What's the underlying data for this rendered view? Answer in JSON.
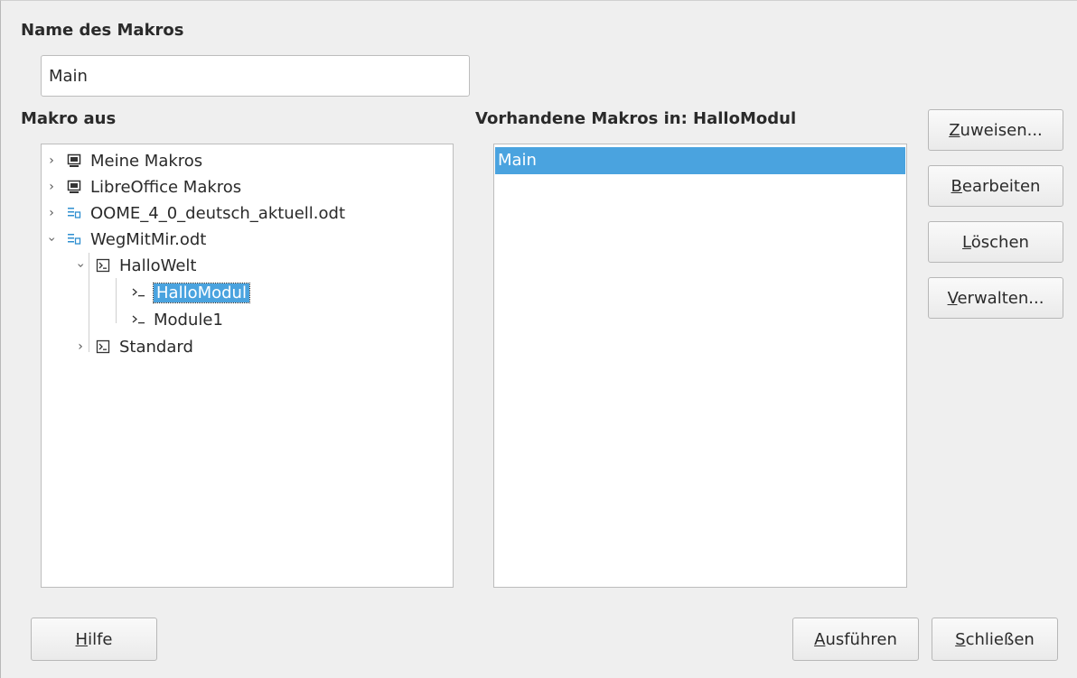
{
  "labels": {
    "name_title": "Name des Makros",
    "source_title": "Makro aus",
    "existing_title": "Vorhandene Makros in: HalloModul"
  },
  "name_input": {
    "value": "Main"
  },
  "tree": {
    "meine_makros": "Meine Makros",
    "libreoffice_makros": "LibreOffice Makros",
    "oome_doc": "OOME_4_0_deutsch_aktuell.odt",
    "wegmitmir_doc": "WegMitMir.odt",
    "hallowelt": "HalloWelt",
    "hallomodul": "HalloModul",
    "module1": "Module1",
    "standard": "Standard"
  },
  "existing_list": [
    "Main"
  ],
  "buttons": {
    "assign": {
      "mnemonic": "Z",
      "rest": "uweisen..."
    },
    "edit": {
      "mnemonic": "B",
      "rest": "earbeiten"
    },
    "delete": {
      "pre": "",
      "mnemonic": "L",
      "rest": "öschen"
    },
    "organize": {
      "mnemonic": "V",
      "rest": "erwalten..."
    },
    "help": {
      "mnemonic": "H",
      "rest": "ilfe"
    },
    "run": {
      "mnemonic": "A",
      "rest": "usführen"
    },
    "close": {
      "mnemonic": "S",
      "rest": "chließen"
    }
  }
}
